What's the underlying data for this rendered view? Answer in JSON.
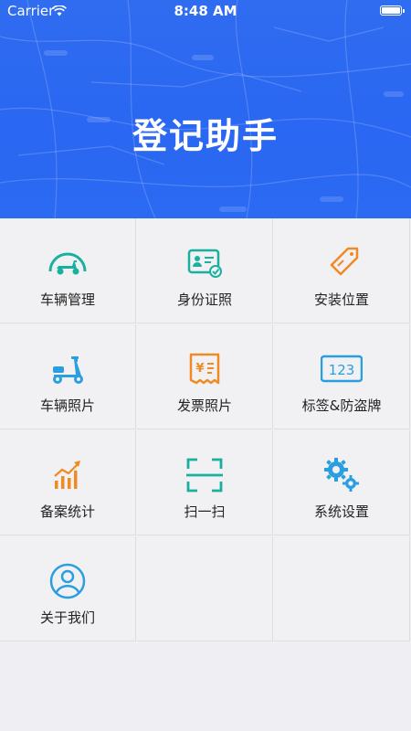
{
  "status_bar": {
    "carrier": "Carrier",
    "time": "8:48 AM"
  },
  "header": {
    "title": "登记助手"
  },
  "menu": {
    "items": [
      {
        "label": "车辆管理",
        "icon": "scooter-speed-icon",
        "color": "#19b0a0"
      },
      {
        "label": "身份证照",
        "icon": "id-card-icon",
        "color": "#19b0a0"
      },
      {
        "label": "安装位置",
        "icon": "tag-icon",
        "color": "#f08a24"
      },
      {
        "label": "车辆照片",
        "icon": "scooter-icon",
        "color": "#2a9fe0"
      },
      {
        "label": "发票照片",
        "icon": "invoice-icon",
        "color": "#f08a24"
      },
      {
        "label": "标签&防盗牌",
        "icon": "plate-123-icon",
        "color": "#2a9fe0"
      },
      {
        "label": "备案统计",
        "icon": "statistics-chart-icon",
        "color": "#f08a24"
      },
      {
        "label": "扫一扫",
        "icon": "scan-icon",
        "color": "#19b0a0"
      },
      {
        "label": "系统设置",
        "icon": "gears-icon",
        "color": "#2a9fe0"
      },
      {
        "label": "关于我们",
        "icon": "user-circle-icon",
        "color": "#2a9fe0"
      }
    ]
  }
}
